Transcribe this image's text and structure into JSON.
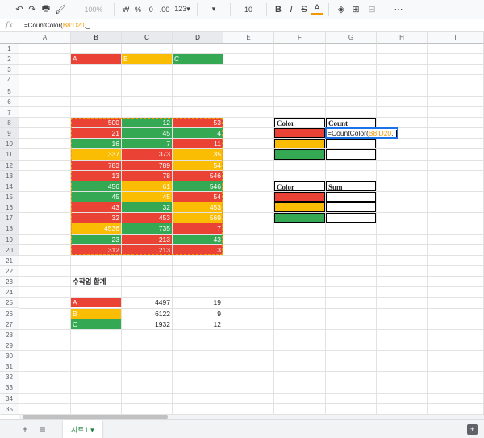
{
  "toolbar": {
    "undo": "↶",
    "redo": "↷",
    "print": "🖶",
    "paint": "🖌",
    "zoom": "100%",
    "currency": "₩",
    "percent": "%",
    "dec_less": ".0",
    "dec_more": ".00",
    "format": "123▾",
    "font_dropdown": "▾",
    "font_size": "10",
    "bold": "B",
    "italic": "I",
    "strike": "S",
    "text_color": "A",
    "fill": "◈",
    "borders": "⊞",
    "merge": "⊟",
    "more": "⋯"
  },
  "formula": {
    "fx": "fx",
    "prefix": "=CountColor(",
    "ref": "B8:D20",
    "suffix": ",_"
  },
  "columns": [
    "A",
    "B",
    "C",
    "D",
    "E",
    "F",
    "G",
    "H",
    "I"
  ],
  "rows": [
    "1",
    "2",
    "3",
    "4",
    "5",
    "6",
    "7",
    "8",
    "9",
    "10",
    "11",
    "12",
    "13",
    "14",
    "15",
    "16",
    "17",
    "18",
    "19",
    "20",
    "21",
    "22",
    "23",
    "24",
    "25",
    "26",
    "27",
    "28",
    "29",
    "30",
    "31",
    "32",
    "33",
    "34",
    "35"
  ],
  "legend": [
    "A",
    "B",
    "C"
  ],
  "data_rows": [
    [
      "500",
      "12",
      "53"
    ],
    [
      "21",
      "45",
      "4"
    ],
    [
      "16",
      "7",
      "11"
    ],
    [
      "337",
      "373",
      "35"
    ],
    [
      "783",
      "789",
      "54"
    ],
    [
      "13",
      "78",
      "546"
    ],
    [
      "456",
      "61",
      "546"
    ],
    [
      "45",
      "45",
      "54"
    ],
    [
      "43",
      "32",
      "453"
    ],
    [
      "32",
      "453",
      "569"
    ],
    [
      "4536",
      "735",
      "7"
    ],
    [
      "23",
      "213",
      "43"
    ],
    [
      "312",
      "213",
      "3"
    ]
  ],
  "data_colors": [
    [
      "red",
      "green",
      "red"
    ],
    [
      "red",
      "green",
      "green"
    ],
    [
      "green",
      "green",
      "red"
    ],
    [
      "yellow",
      "red",
      "yellow"
    ],
    [
      "red",
      "red",
      "yellow"
    ],
    [
      "red",
      "red",
      "red"
    ],
    [
      "green",
      "yellow",
      "green"
    ],
    [
      "green",
      "yellow",
      "red"
    ],
    [
      "red",
      "green",
      "yellow"
    ],
    [
      "red",
      "red",
      "yellow"
    ],
    [
      "yellow",
      "green",
      "red"
    ],
    [
      "green",
      "red",
      "green"
    ],
    [
      "red",
      "red",
      "red"
    ]
  ],
  "count_table": {
    "header_color": "Color",
    "header_value": "Count",
    "editing_text_prefix": "=CountColor(",
    "editing_text_ref": "B8:D20",
    "editing_text_suffix": ","
  },
  "sum_table": {
    "header_color": "Color",
    "header_value": "Sum"
  },
  "manual_title": "수작업 합계",
  "manual_rows": [
    {
      "label": "A",
      "color": "red",
      "sum": "4497",
      "count": "19"
    },
    {
      "label": "B",
      "color": "yellow",
      "sum": "6122",
      "count": "9"
    },
    {
      "label": "C",
      "color": "green",
      "sum": "1932",
      "count": "12"
    }
  ],
  "sheet_tab": "시트1 ▾",
  "tabbar": {
    "add": "+",
    "list": "≡",
    "explore": "+"
  },
  "colors": {
    "red": "#ea4335",
    "yellow": "#fbbc04",
    "green": "#34a853",
    "selection": "#1a73e8",
    "range": "#f29900"
  }
}
